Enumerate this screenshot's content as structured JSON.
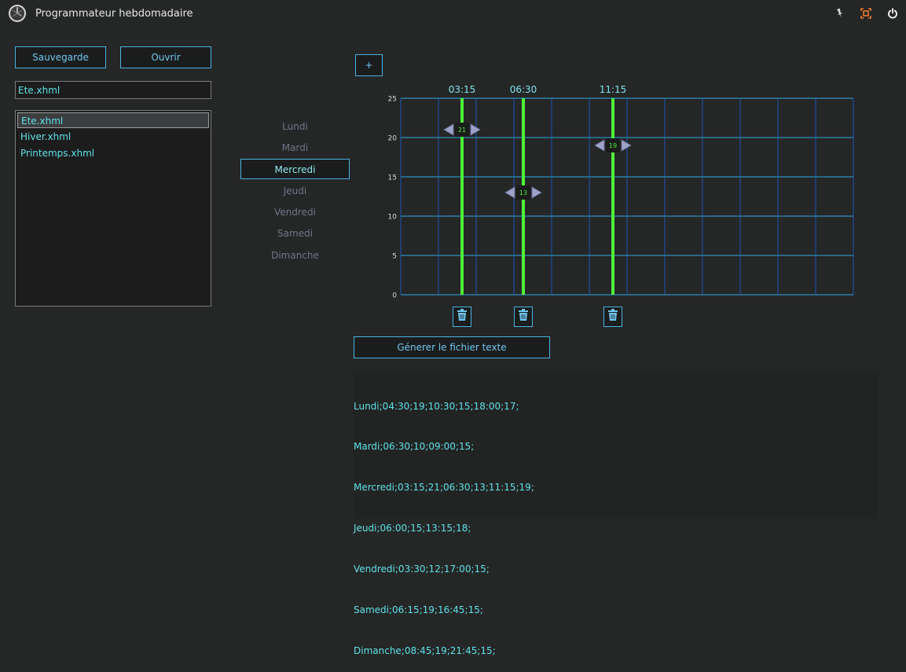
{
  "window": {
    "title": "Programmateur hebdomadaire",
    "logo_icon": "app-logo-icon",
    "controls": [
      {
        "name": "pin-icon",
        "color": "#d8d8d8"
      },
      {
        "name": "maximize-icon",
        "color": "#f07a2a"
      },
      {
        "name": "power-icon",
        "color": "#ffffff"
      }
    ]
  },
  "toolbar": {
    "save_label": "Sauvegarde",
    "open_label": "Ouvrir",
    "add_label": "+"
  },
  "file": {
    "name_value": "Ete.xhml",
    "list": [
      "Ete.xhml",
      "Hiver.xhml",
      "Printemps.xhml"
    ],
    "selected_index": 0
  },
  "days": {
    "items": [
      "Lundi",
      "Mardi",
      "Mercredi",
      "Jeudi",
      "Vendredi",
      "Samedi",
      "Dimanche"
    ],
    "selected_index": 2
  },
  "chart_data": {
    "type": "line",
    "y_ticks": [
      "0",
      "5",
      "10",
      "15",
      "20",
      "25"
    ],
    "ylim": [
      0,
      25
    ],
    "grid": true,
    "grid_columns": 12,
    "colors": {
      "grid": "#1f4fa3",
      "horizontal_grid": "#2a7ea6",
      "marker": "#4ef038"
    },
    "markers": [
      {
        "time": "03:15",
        "value": 21
      },
      {
        "time": "06:30",
        "value": 13
      },
      {
        "time": "11:15",
        "value": 19
      }
    ]
  },
  "generate_label": "Génerer le fichier texte",
  "output": {
    "lines": [
      "Lundi;04:30;19;10:30;15;18:00;17;",
      "Mardi;06:30;10;09:00;15;",
      "Mercredi;03:15;21;06:30;13;11:15;19;",
      "Jeudi;06:00;15;13:15;18;",
      "Vendredi;03:30;12;17:00;15;",
      "Samedi;06:15;19;16:45;15;",
      "Dimanche;08:45;19;21:45;15;"
    ]
  }
}
